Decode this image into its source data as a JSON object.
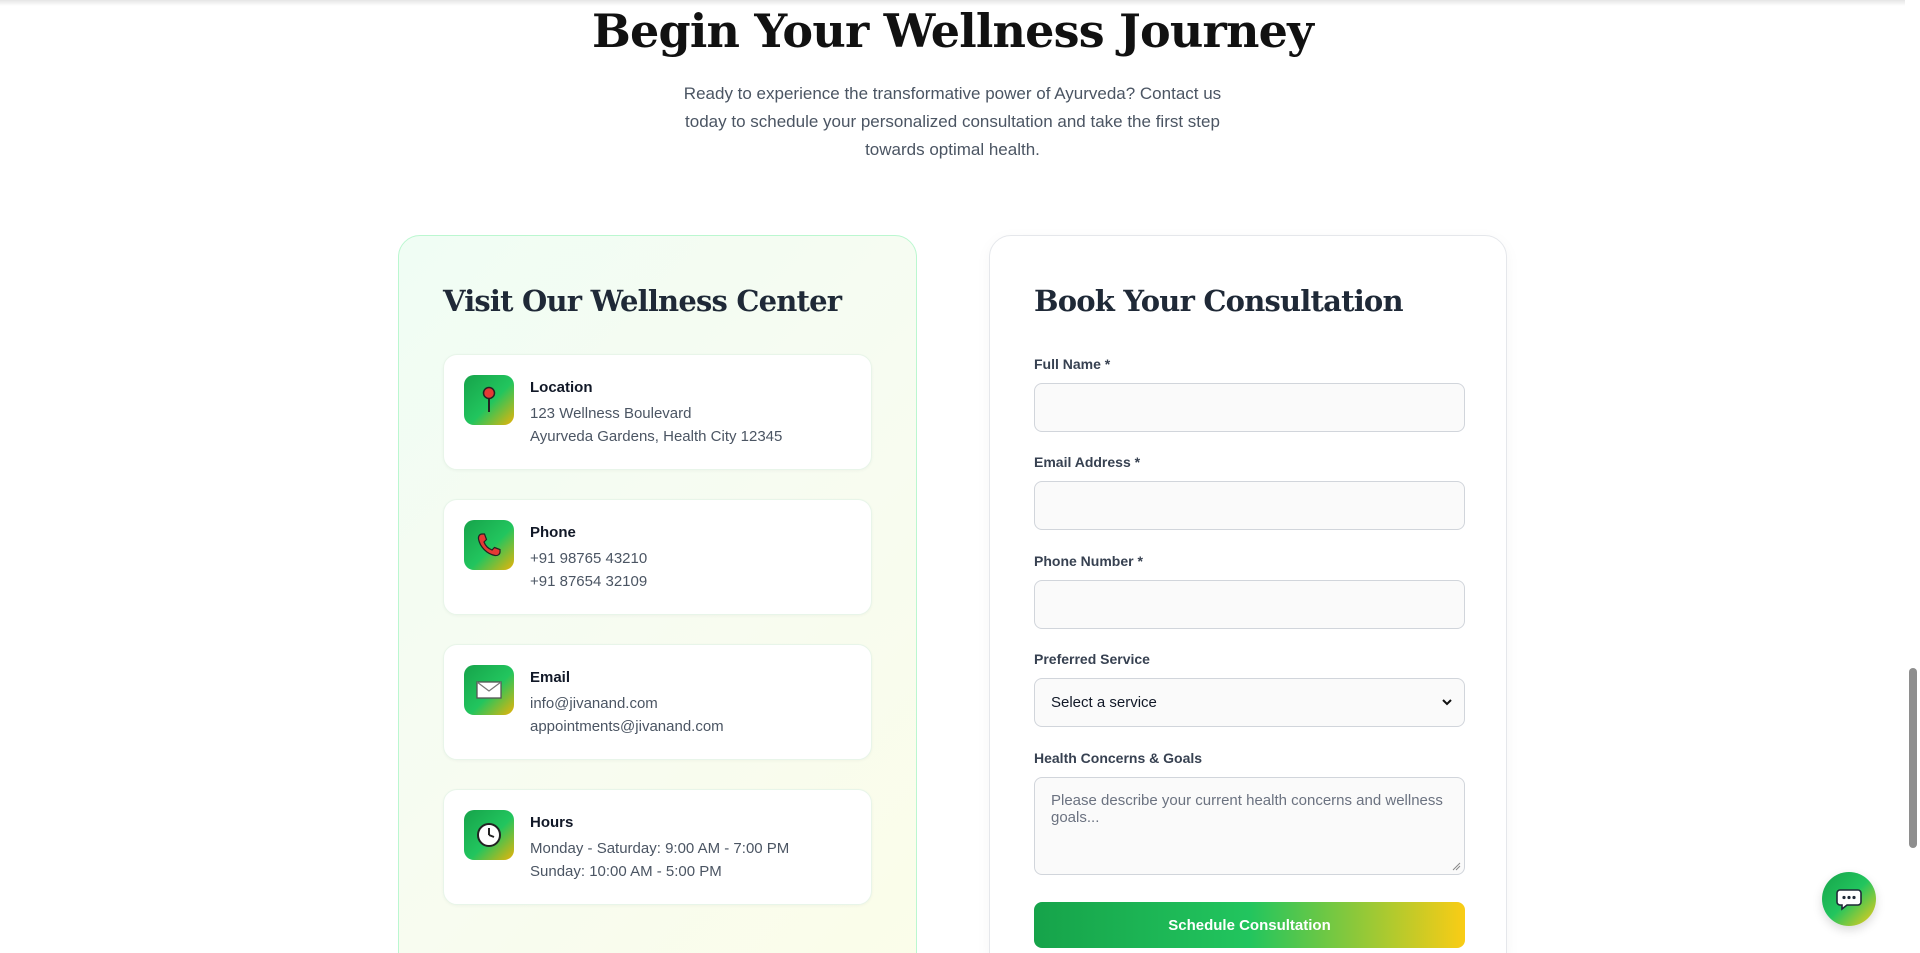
{
  "section": {
    "title": "Begin Your Wellness Journey",
    "subtitle": "Ready to experience the transformative power of Ayurveda? Contact us today to schedule your personalized consultation and take the first step towards optimal health."
  },
  "info": {
    "heading": "Visit Our Wellness Center",
    "cards": [
      {
        "title": "Location",
        "line1": "123 Wellness Boulevard",
        "line2": "Ayurveda Gardens, Health City 12345",
        "icon": "pushpin-icon"
      },
      {
        "title": "Phone",
        "line1": "+91 98765 43210",
        "line2": "+91 87654 32109",
        "icon": "telephone-icon"
      },
      {
        "title": "Email",
        "line1": "info@jivanand.com",
        "line2": "appointments@jivanand.com",
        "icon": "envelope-icon"
      },
      {
        "title": "Hours",
        "line1": "Monday - Saturday: 9:00 AM - 7:00 PM",
        "line2": "Sunday: 10:00 AM - 5:00 PM",
        "icon": "clock-icon"
      }
    ]
  },
  "form": {
    "heading": "Book Your Consultation",
    "full_name": {
      "label": "Full Name *",
      "value": ""
    },
    "email": {
      "label": "Email Address *",
      "value": ""
    },
    "phone": {
      "label": "Phone Number *",
      "value": ""
    },
    "service": {
      "label": "Preferred Service",
      "selected": "Select a service"
    },
    "concerns": {
      "label": "Health Concerns & Goals",
      "placeholder": "Please describe your current health concerns and wellness goals..."
    },
    "submit_label": "Schedule Consultation"
  },
  "colors": {
    "accent_green": "#16a34a",
    "accent_yellow": "#facc15"
  },
  "chat": {
    "icon": "chat-bubble-icon"
  }
}
